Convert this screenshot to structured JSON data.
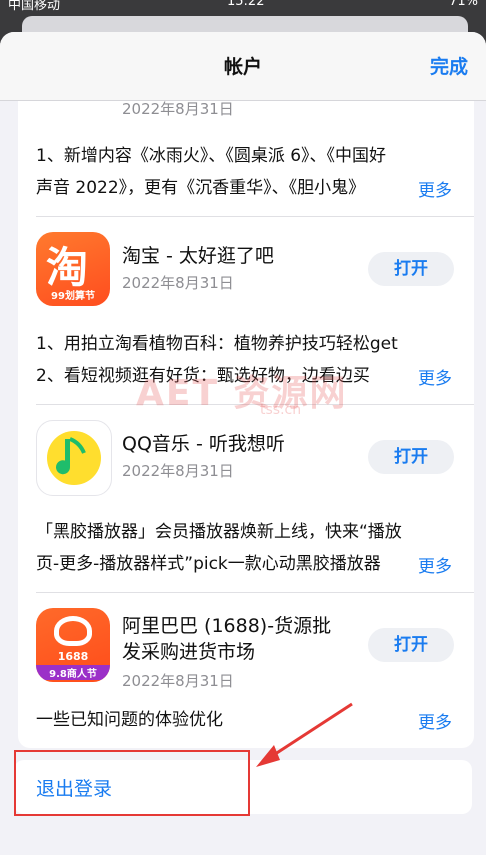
{
  "status": {
    "carrier": "中国移动",
    "time": "15:22",
    "battery": "71%"
  },
  "nav": {
    "title": "帐户",
    "done": "完成"
  },
  "apps": [
    {
      "name": "",
      "date": "2022年8月31日",
      "notes": [
        "1、新增内容《冰雨火》、《圆桌派 6》、《中国好",
        "声音 2022》，更有《沉香重华》、《胆小鬼》"
      ],
      "more": "更多"
    },
    {
      "name": "淘宝 - 太好逛了吧",
      "date": "2022年8月31日",
      "open": "打开",
      "icon_text": "淘",
      "icon_badge": "99划算节",
      "notes": [
        "1、用拍立淘看植物百科：植物养护技巧轻松get",
        "2、看短视频逛有好货：甄选好物，边看边买"
      ],
      "more": "更多"
    },
    {
      "name": "QQ音乐 - 听我想听",
      "date": "2022年8月31日",
      "open": "打开",
      "notes": [
        "「黑胶播放器」会员播放器焕新上线，快来“播放",
        "页-更多-播放器样式”pick一款心动黑胶播放器"
      ],
      "more": "更多"
    },
    {
      "name_lines": [
        "阿里巴巴 (1688)-货源批",
        "发采购进货市场"
      ],
      "date": "2022年8月31日",
      "open": "打开",
      "icon_num": "1688",
      "icon_badge": "9.8商人节",
      "notes": [
        "一些已知问题的体验优化"
      ],
      "more": "更多"
    }
  ],
  "logout": "退出登录",
  "watermark": {
    "main": "AET 资源网",
    "sub": "tss.cn"
  },
  "colors": {
    "accent": "#1a7cf0",
    "annotation": "#e53935"
  }
}
